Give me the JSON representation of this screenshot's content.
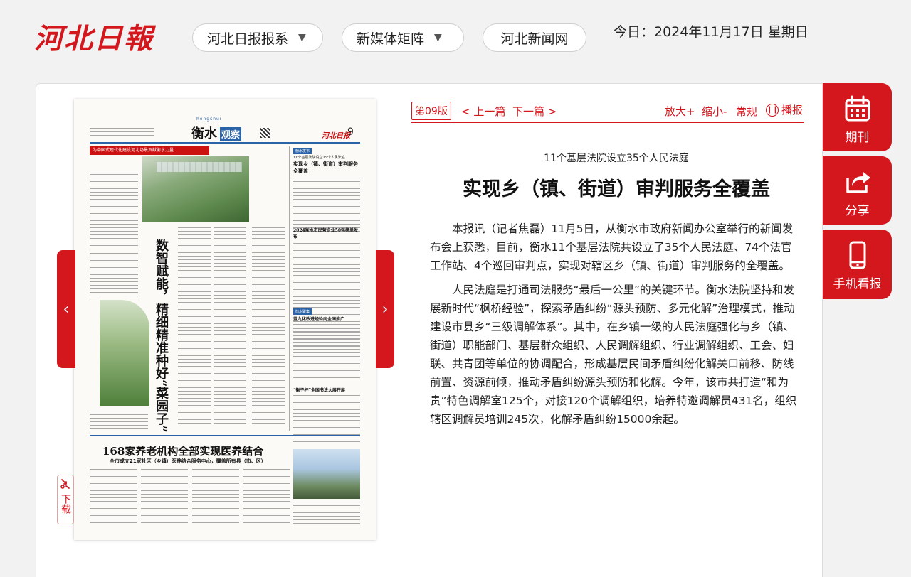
{
  "header": {
    "logo_text": "河北日報",
    "nav": [
      {
        "label": "河北日报报系",
        "has_dropdown": true
      },
      {
        "label": "新媒体矩阵",
        "has_dropdown": true
      },
      {
        "label": "河北新闻网",
        "has_dropdown": false
      }
    ],
    "date_text": "今日：2024年11月17日 星期日",
    "caret": "▼"
  },
  "paper": {
    "masthead": "衡水",
    "masthead_box": "观察",
    "masthead_sub": "hengshui",
    "brand": "河北日报",
    "page_no": "9",
    "red_banner": "为中国式现代化建设河北场景贡献衡水力量",
    "vertical_headline": "数智赋能，精细精准种好“菜园子”",
    "section1_tag": "衡水发布",
    "section1_kicker": "11个基层法院设立35个人民法庭",
    "section1_title": "实现乡（镇、街道）审判服务全覆盖",
    "section2_title": "2024衡水市民营企业50强榜单发布",
    "section3_tag": "衡水聚集",
    "section3_title": "蓝九化改进经验向全国推广",
    "section4_title": "“衡子杯”全国书法大展开展",
    "big_headline": "168家养老机构全部实现医养结合",
    "big_subheadline": "全市成立21家社区（乡镇）医养结合服务中心，覆盖所有县（市、区）"
  },
  "colors": {
    "brand_red": "#d4161d",
    "paper_blue": "#2a63a8"
  },
  "toolbar": {
    "edition": "第09版",
    "prev": "< 上一篇",
    "next": "下一篇 >",
    "zoom_in": "放大+",
    "zoom_out": "缩小-",
    "normal": "常规",
    "play": "播报"
  },
  "article": {
    "subtitle": "11个基层法院设立35个人民法庭",
    "title": "实现乡（镇、街道）审判服务全覆盖",
    "paragraphs": [
      "本报讯（记者焦磊）11月5日，从衡水市政府新闻办公室举行的新闻发布会上获悉，目前，衡水11个基层法院共设立了35个人民法庭、74个法官工作站、4个巡回审判点，实现对辖区乡（镇、街道）审判服务的全覆盖。",
      "人民法庭是打通司法服务“最后一公里”的关键环节。衡水法院坚持和发展新时代“枫桥经验”，探索矛盾纠纷“源头预防、多元化解”治理模式，推动建设市县乡“三级调解体系”。其中，在乡镇一级的人民法庭强化与乡（镇、街道）职能部门、基层群众组织、人民调解组织、行业调解组织、工会、妇联、共青团等单位的协调配合，形成基层民间矛盾纠纷化解关口前移、防线前置、资源前倾，推动矛盾纠纷源头预防和化解。今年，该市共打造“和为贵”特色调解室125个，对接120个调解组织，培养特邀调解员431名，组织辖区调解员培训245次，化解矛盾纠纷15000余起。"
    ]
  },
  "side_nav": [
    {
      "label": "期刊",
      "icon": "calendar-icon"
    },
    {
      "label": "分享",
      "icon": "share-icon"
    },
    {
      "label": "手机看报",
      "icon": "phone-icon"
    }
  ],
  "download": {
    "label": "下载",
    "icon": "download-icon"
  },
  "arrows": {
    "left": "‹",
    "right": "›"
  }
}
